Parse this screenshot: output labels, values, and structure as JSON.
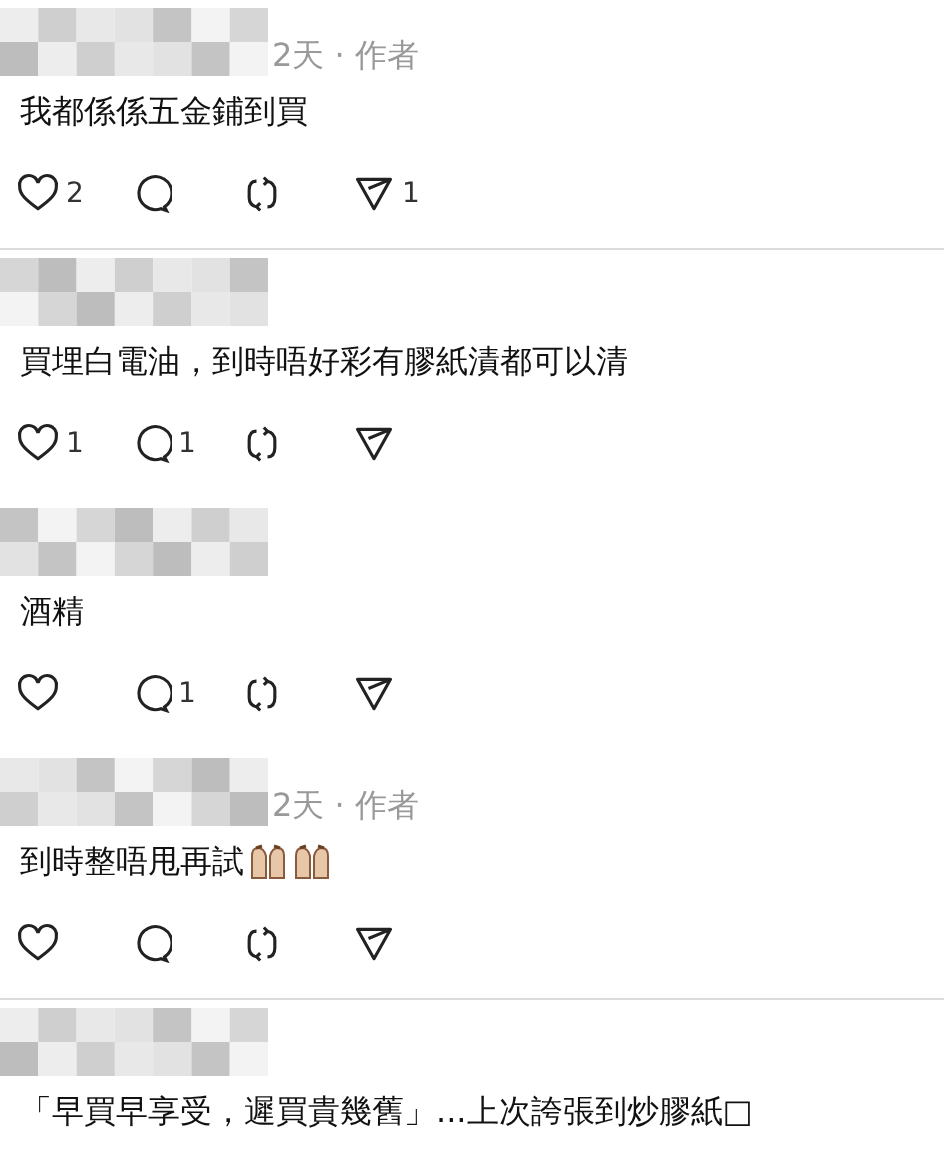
{
  "posts": [
    {
      "meta": "2天 · 作者",
      "text": "我都係係五金鋪到買",
      "likes": "2",
      "shares": "1",
      "divider": true
    },
    {
      "text": "買埋白電油，到時唔好彩有膠紙漬都可以清",
      "likes": "1",
      "replies": "1",
      "divider": false
    },
    {
      "text": "酒精",
      "replies": "1",
      "divider": false
    },
    {
      "meta": "2天 · 作者",
      "text": "到時整唔甩再試",
      "emoji": [
        {
          "kind": "hands"
        },
        {
          "kind": "hands"
        }
      ],
      "divider": true
    },
    {
      "text": "「早買早享受，遲買貴幾舊」...上次誇張到炒膠紙□",
      "divider": false
    }
  ]
}
